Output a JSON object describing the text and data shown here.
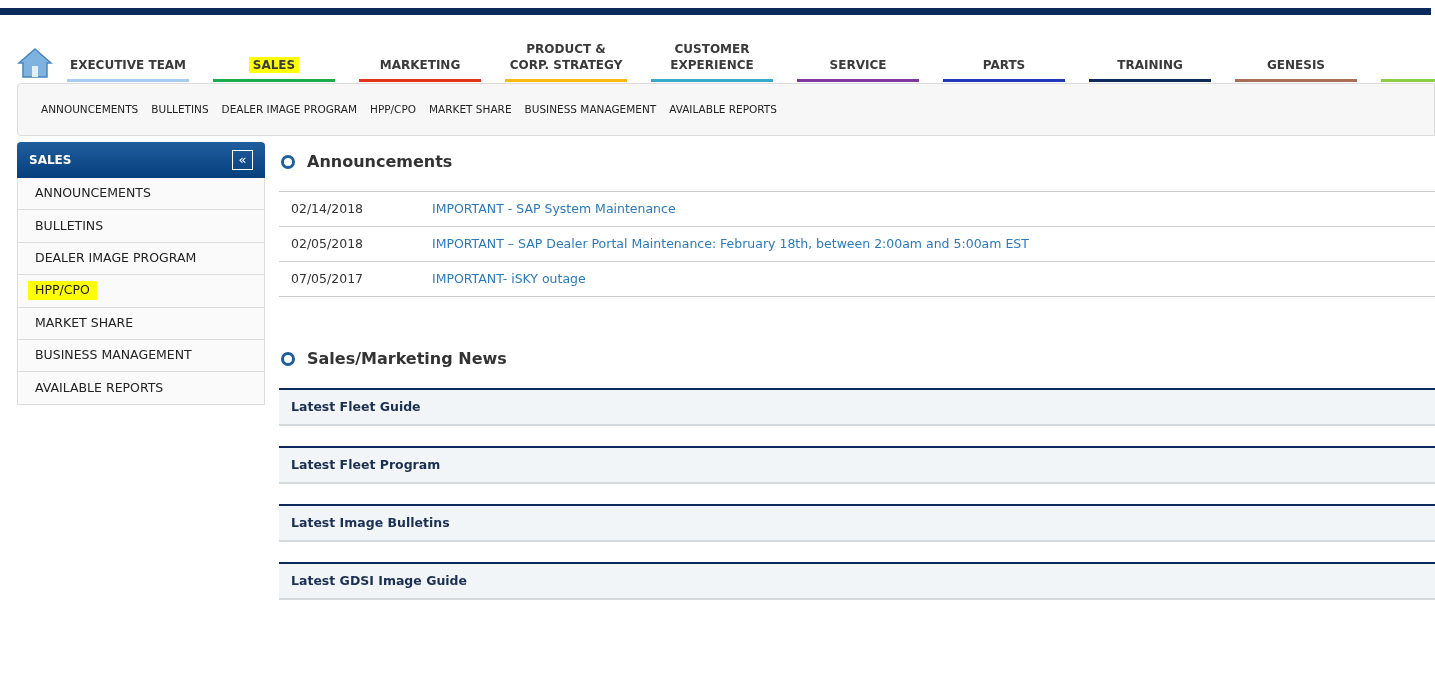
{
  "main_nav": [
    {
      "label": "EXECUTIVE TEAM",
      "color": "#a9cdf2",
      "highlighted": false
    },
    {
      "label": "SALES",
      "color": "#1aab4b",
      "highlighted": true
    },
    {
      "label": "MARKETING",
      "color": "#e2331b",
      "highlighted": false
    },
    {
      "label": "PRODUCT &\nCORP. STRATEGY",
      "color": "#f9b90f",
      "highlighted": false
    },
    {
      "label": "CUSTOMER\nEXPERIENCE",
      "color": "#35aacb",
      "highlighted": false
    },
    {
      "label": "SERVICE",
      "color": "#7e38a0",
      "highlighted": false
    },
    {
      "label": "PARTS",
      "color": "#2238b8",
      "highlighted": false
    },
    {
      "label": "TRAINING",
      "color": "#0e2a5a",
      "highlighted": false
    },
    {
      "label": "GENESIS",
      "color": "#a86e55",
      "highlighted": false
    },
    {
      "color": "#8ccf45"
    }
  ],
  "sub_nav": [
    "ANNOUNCEMENTS",
    "BULLETINS",
    "DEALER IMAGE PROGRAM",
    "HPP/CPO",
    "MARKET SHARE",
    "BUSINESS MANAGEMENT",
    "AVAILABLE REPORTS"
  ],
  "sidebar": {
    "title": "SALES",
    "collapse_glyph": "«",
    "items": [
      {
        "label": "ANNOUNCEMENTS",
        "highlighted": false
      },
      {
        "label": "BULLETINS",
        "highlighted": false
      },
      {
        "label": "DEALER IMAGE PROGRAM",
        "highlighted": false
      },
      {
        "label": "HPP/CPO",
        "highlighted": true
      },
      {
        "label": "MARKET SHARE",
        "highlighted": false
      },
      {
        "label": "BUSINESS MANAGEMENT",
        "highlighted": false
      },
      {
        "label": "AVAILABLE REPORTS",
        "highlighted": false
      }
    ]
  },
  "announcements": {
    "title": "Announcements",
    "rows": [
      {
        "date": "02/14/2018",
        "title": "IMPORTANT - SAP System Maintenance"
      },
      {
        "date": "02/05/2018",
        "title": "IMPORTANT – SAP Dealer Portal Maintenance: February 18th, between 2:00am and 5:00am EST"
      },
      {
        "date": "07/05/2017",
        "title": "IMPORTANT- iSKY outage"
      }
    ]
  },
  "news": {
    "title": "Sales/Marketing News",
    "items": [
      "Latest Fleet Guide",
      "Latest Fleet Program",
      "Latest Image Bulletins",
      "Latest GDSI Image Guide"
    ]
  }
}
